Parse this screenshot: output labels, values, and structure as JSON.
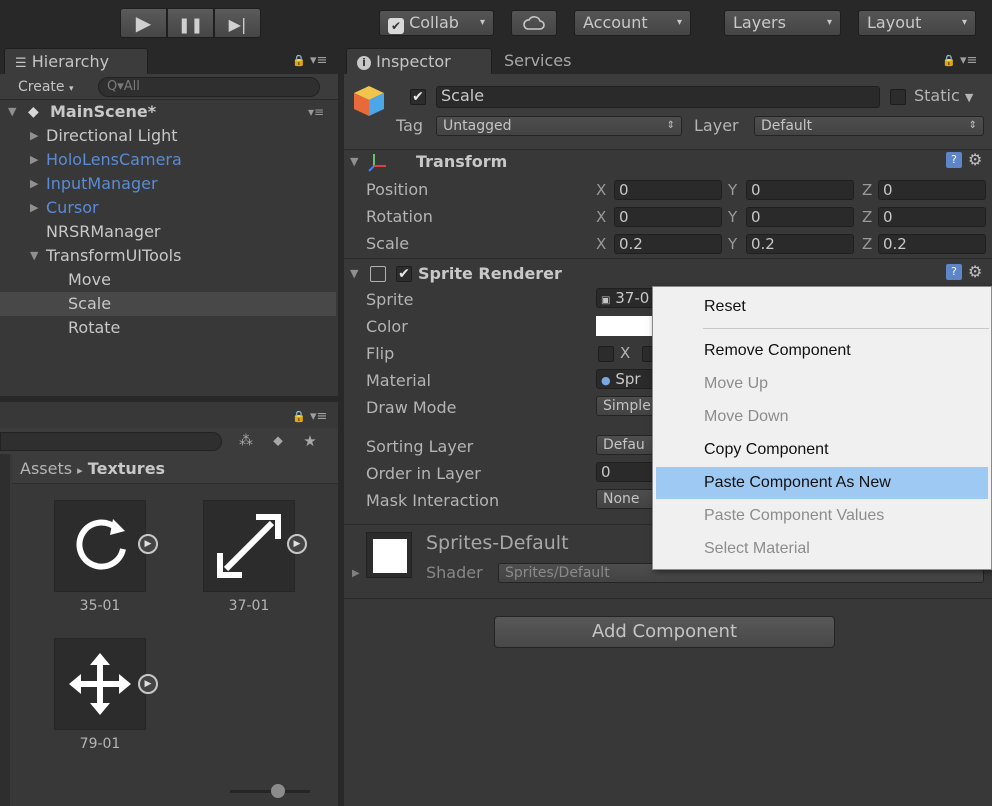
{
  "toolbar": {
    "play_icon": "▶",
    "pause_icon": "❚❚",
    "step_icon": "▶|",
    "collab": "Collab",
    "account": "Account",
    "layers": "Layers",
    "layout": "Layout",
    "dropdown_arrow": "▾"
  },
  "hierarchy": {
    "tab": "Hierarchy",
    "create": "Create",
    "search_placeholder": "Q▾All",
    "scene": "MainScene*",
    "items": [
      {
        "label": "Directional Light"
      },
      {
        "label": "HoloLensCamera"
      },
      {
        "label": "InputManager"
      },
      {
        "label": "Cursor"
      },
      {
        "label": "NRSRManager"
      },
      {
        "label": "TransformUITools"
      },
      {
        "label": "Move"
      },
      {
        "label": "Scale"
      },
      {
        "label": "Rotate"
      }
    ]
  },
  "project": {
    "breadcrumb_root": "Assets",
    "breadcrumb_sep": "▸",
    "breadcrumb_current": "Textures",
    "assets": [
      {
        "label": "35-01",
        "icon": "rotate-icon"
      },
      {
        "label": "37-01",
        "icon": "scale-arrows-icon"
      },
      {
        "label": "79-01",
        "icon": "move-arrows-icon"
      }
    ]
  },
  "inspector": {
    "tab": "Inspector",
    "tab2": "Services",
    "object_name": "Scale",
    "static_label": "Static",
    "tag_label": "Tag",
    "tag_value": "Untagged",
    "layer_label": "Layer",
    "layer_value": "Default",
    "transform": {
      "title": "Transform",
      "rows": [
        {
          "label": "Position",
          "x": "0",
          "y": "0",
          "z": "0"
        },
        {
          "label": "Rotation",
          "x": "0",
          "y": "0",
          "z": "0"
        },
        {
          "label": "Scale",
          "x": "0.2",
          "y": "0.2",
          "z": "0.2"
        }
      ],
      "axis_x": "X",
      "axis_y": "Y",
      "axis_z": "Z"
    },
    "sprite_renderer": {
      "title": "Sprite Renderer",
      "sprite_label": "Sprite",
      "sprite_value": "37-0",
      "color_label": "Color",
      "flip_label": "Flip",
      "flip_x": "X",
      "material_label": "Material",
      "material_value": "Spr",
      "draw_mode_label": "Draw Mode",
      "draw_mode_value": "Simple",
      "sorting_layer_label": "Sorting Layer",
      "sorting_layer_value": "Defau",
      "order_label": "Order in Layer",
      "order_value": "0",
      "mask_label": "Mask Interaction",
      "mask_value": "None"
    },
    "material": {
      "name": "Sprites-Default",
      "shader_label": "Shader",
      "shader_value": "Sprites/Default"
    },
    "add_component": "Add Component"
  },
  "context_menu": {
    "items": [
      {
        "label": "Reset",
        "enabled": true
      },
      {
        "label": "Remove Component",
        "enabled": true
      },
      {
        "label": "Move Up",
        "enabled": false
      },
      {
        "label": "Move Down",
        "enabled": false
      },
      {
        "label": "Copy Component",
        "enabled": true
      },
      {
        "label": "Paste Component As New",
        "enabled": true,
        "highlighted": true
      },
      {
        "label": "Paste Component Values",
        "enabled": false
      },
      {
        "label": "Select Material",
        "enabled": false
      }
    ]
  },
  "colors": {
    "menu_highlight": "#9ec9f3",
    "prefab_blue": "#5b8bd4",
    "panel_bg": "#383838"
  }
}
